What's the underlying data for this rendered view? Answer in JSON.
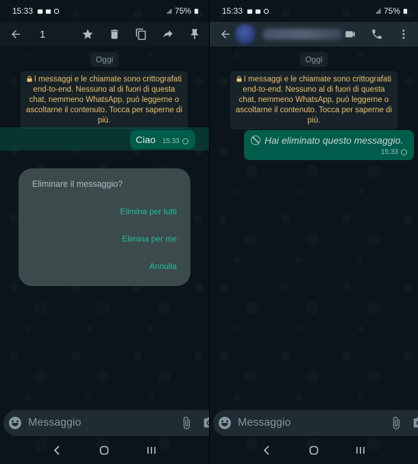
{
  "status": {
    "time": "15:33",
    "battery": "75%"
  },
  "left_screen": {
    "selection_count": "1",
    "date_chip": "Oggi",
    "encryption_notice": "I messaggi e le chiamate sono crittografati end-to-end. Nessuno al di fuori di questa chat, nemmeno WhatsApp, può leggerne o ascoltarne il contenuto. Tocca per saperne di più.",
    "message": {
      "text": "Ciao",
      "time": "15:33"
    },
    "dialog": {
      "title": "Eliminare il messaggio?",
      "option_delete_all": "Elimina per tutti",
      "option_delete_me": "Elimina per me",
      "option_cancel": "Annulla"
    },
    "input_placeholder": "Messaggio"
  },
  "right_screen": {
    "date_chip": "Oggi",
    "encryption_notice": "I messaggi e le chiamate sono crittografati end-to-end. Nessuno al di fuori di questa chat, nemmeno WhatsApp, può leggerne o ascoltarne il contenuto. Tocca per saperne di più.",
    "deleted_message": {
      "text": "Hai eliminato questo messaggio.",
      "time": "15:33"
    },
    "input_placeholder": "Messaggio"
  },
  "colors": {
    "accent": "#00a884",
    "bubble_out": "#005c4b",
    "background": "#0b141a",
    "notice_text": "#e7c26b"
  }
}
